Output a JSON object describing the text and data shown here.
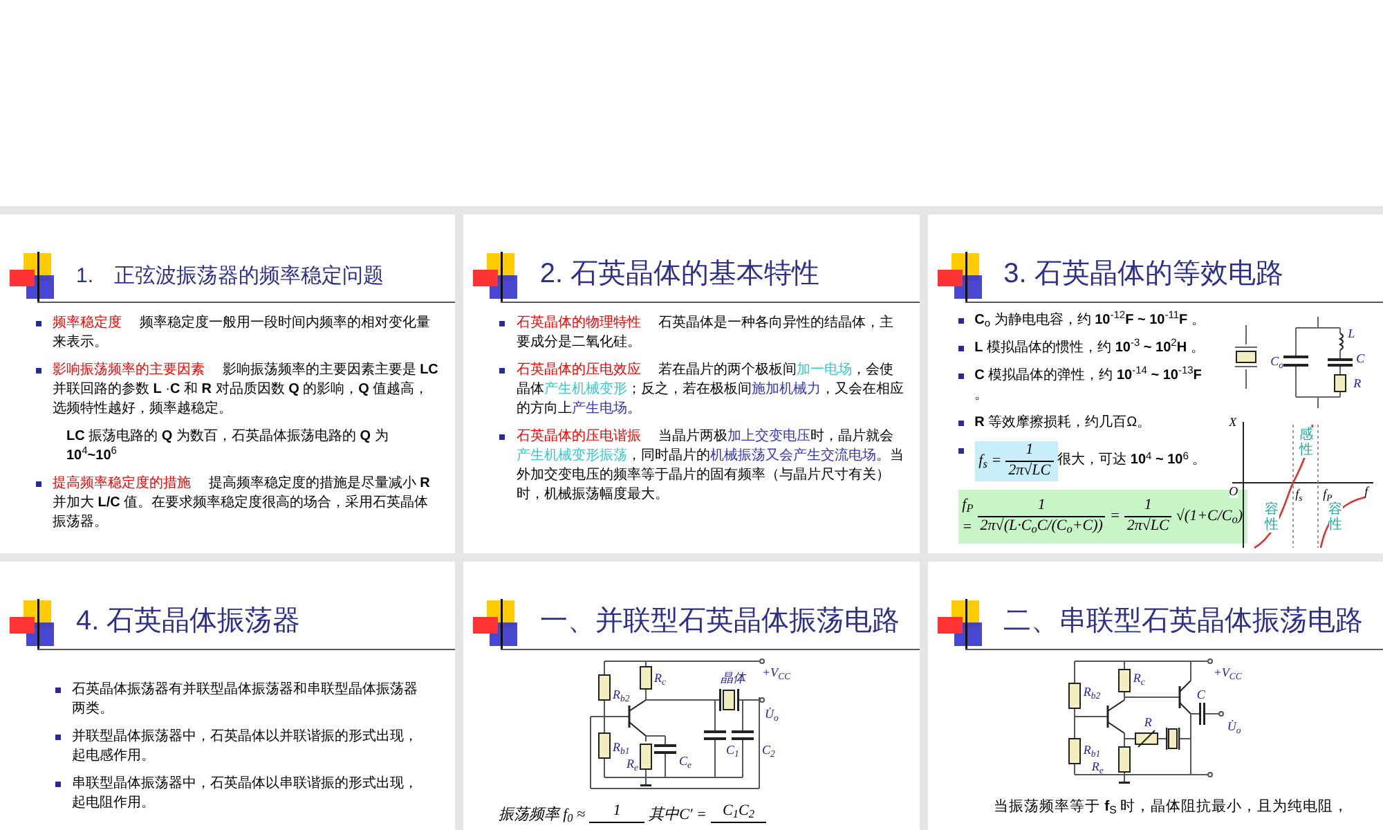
{
  "slides": [
    {
      "kind": "text",
      "title": "1.　正弦波振荡器的频率稳定问题",
      "bullets": [
        {
          "kind": "bullet",
          "segments": [
            {
              "text": "频率稳定度",
              "color": "#ff0000"
            },
            {
              "text": "　 频率稳定度一般用一段时间内频率的相对变化量来表示。"
            }
          ]
        },
        {
          "kind": "bullet",
          "segments": [
            {
              "text": "影响振荡频率的主要因素",
              "color": "#ff0000"
            },
            {
              "text": "　 影响振荡频率的主要因素主要是 **LC** 并联回路的参数 **L** ·**C** 和 **R** 对品质因数 **Q** 的影响，**Q** 值越高，选频特性越好，频率越稳定。"
            }
          ]
        },
        {
          "kind": "note",
          "segments": [
            {
              "text": "**LC** 振荡电路的 **Q** 为数百，石英晶体振荡电路的 **Q** 为 **10**$^{4}$**~10**$^{6}$"
            }
          ]
        },
        {
          "kind": "bullet",
          "segments": [
            {
              "text": "提高频率稳定度的措施",
              "color": "#ff0000"
            },
            {
              "text": "　 提高频率稳定度的措施是尽量减小 **R** 并加大 **L/C** 值。在要求频率稳定度很高的场合，采用石英晶体振荡器。"
            }
          ]
        }
      ]
    },
    {
      "kind": "text",
      "title": "2. 石英晶体的基本特性",
      "bullets": [
        {
          "kind": "bullet",
          "segments": [
            {
              "text": "石英晶体的物理特性",
              "color": "#ff0000"
            },
            {
              "text": "　 石英晶体是一种各向异性的结晶体，主要成分是二氧化硅。"
            }
          ]
        },
        {
          "kind": "bullet",
          "segments": [
            {
              "text": "石英晶体的压电效应",
              "color": "#ff0000"
            },
            {
              "text": "　 若在晶片的两个极板间"
            },
            {
              "text": "加一电场",
              "color": "#33cccc"
            },
            {
              "text": "，会使晶体"
            },
            {
              "text": "产生机械变形",
              "color": "#33cccc"
            },
            {
              "text": "；反之，若在极板间"
            },
            {
              "text": "施加机械力",
              "color": "#3333cc"
            },
            {
              "text": "，又会在相应的方向上"
            },
            {
              "text": "产生电场",
              "color": "#3333cc"
            },
            {
              "text": "。"
            }
          ]
        },
        {
          "kind": "bullet",
          "segments": [
            {
              "text": "石英晶体的压电谐振",
              "color": "#ff0000"
            },
            {
              "text": "　 当晶片两极"
            },
            {
              "text": "加上交变电压",
              "color": "#3333cc"
            },
            {
              "text": "时，晶片就会"
            },
            {
              "text": "产生机械变形振荡",
              "color": "#33cccc"
            },
            {
              "text": "，同时晶片的"
            },
            {
              "text": "机械振荡又会产生交流电场",
              "color": "#3333cc"
            },
            {
              "text": "。当外加交变电压的频率等于晶片的固有频率（与晶片尺寸有关）时，机械振荡幅度最大。"
            }
          ]
        }
      ]
    },
    {
      "kind": "equivalent",
      "title": "3. 石英晶体的等效电路",
      "bullets": [
        {
          "kind": "bullet",
          "segments": [
            {
              "text": "**C**$_{o}$ 为静电电容，约 **10**$^{-12}$**F ~ 10**$^{-11}$**F** 。"
            }
          ]
        },
        {
          "kind": "bullet",
          "segments": [
            {
              "text": "**L** 模拟晶体的惯性，约 **10**$^{-3}$ **~ 10**$^{2}$**H** 。"
            }
          ]
        },
        {
          "kind": "bullet",
          "segments": [
            {
              "text": "**C** 模拟晶体的弹性，约 **10**$^{-14}$ **~ 10**$^{-13}$**F** 。"
            }
          ]
        },
        {
          "kind": "bullet",
          "segments": [
            {
              "text": "**R** 等效摩擦损耗，约几百Ω。"
            }
          ]
        },
        {
          "kind": "formula",
          "formula": [
            {
              "kind": "text",
              "text": "f$_{s}$ ="
            },
            {
              "kind": "fraction",
              "num": "1",
              "den": "2π√LC"
            }
          ],
          "segments": [
            {
              "text": "很大，可达 **10**$^{4}$ **~ 10**$^{6}$ 。"
            }
          ]
        }
      ],
      "formula_block": [
        {
          "kind": "text",
          "text": "f$_{P}$ ="
        },
        {
          "kind": "fraction",
          "num": "1",
          "den": "2π√(L·C$_{o}$C/(C$_{o}$+C))"
        },
        {
          "kind": "text",
          "text": "="
        },
        {
          "kind": "fraction",
          "num": "1",
          "den": "2π√LC"
        },
        {
          "kind": "text",
          "text": "√(1+C/C$_{o}$)"
        }
      ],
      "circuit_labels": [
        "L",
        "C$_{o}$",
        "C",
        "R"
      ],
      "graph_labels": [
        "X",
        "O",
        "f",
        "感性",
        "容性",
        "容性",
        "f$_{s}$",
        "f$_{P}$"
      ]
    },
    {
      "kind": "text",
      "title": "4. 石英晶体振荡器",
      "bullets": [
        {
          "kind": "bullet",
          "segments": [
            {
              "text": "石英晶体振荡器有并联型晶体振荡器和串联型晶体振荡器两类。"
            }
          ]
        },
        {
          "kind": "bullet",
          "segments": [
            {
              "text": "并联型晶体振荡器中，石英晶体以并联谐振的形式出现，起电感作用。"
            }
          ]
        },
        {
          "kind": "bullet",
          "segments": [
            {
              "text": "串联型晶体振荡器中，石英晶体以串联谐振的形式出现，起电阻作用。"
            }
          ]
        }
      ]
    },
    {
      "kind": "parallel",
      "title": "一、并联型石英晶体振荡电路",
      "circuit_labels": [
        "R$_{b2}$",
        "R$_{c}$",
        "晶体",
        "+V$_{CC}$",
        "U̇$_{o}$",
        "R$_{b1}$",
        "R$_{e}$",
        "C$_{e}$",
        "C$_{1}$",
        "C$_{2}$"
      ],
      "caption": [
        {
          "kind": "text",
          "text": "振荡频率 f$_{0}$ ≈"
        },
        {
          "kind": "fraction",
          "num": "1"
        },
        {
          "kind": "text",
          "text": "其中C′ ="
        },
        {
          "kind": "fraction",
          "num": "C$_{1}$C$_{2}$"
        }
      ]
    },
    {
      "kind": "series",
      "title": "二、串联型石英晶体振荡电路",
      "circuit_labels": [
        "R$_{b2}$",
        "R$_{c}$",
        "+V$_{CC}$",
        "C",
        "R",
        "U̇$_{o}$",
        "R$_{b1}$",
        "R$_{e}$"
      ],
      "caption_text": "当振荡频率等于 **f**$_{S}$ 时，晶体阻抗最小，且为纯电阻，"
    }
  ]
}
